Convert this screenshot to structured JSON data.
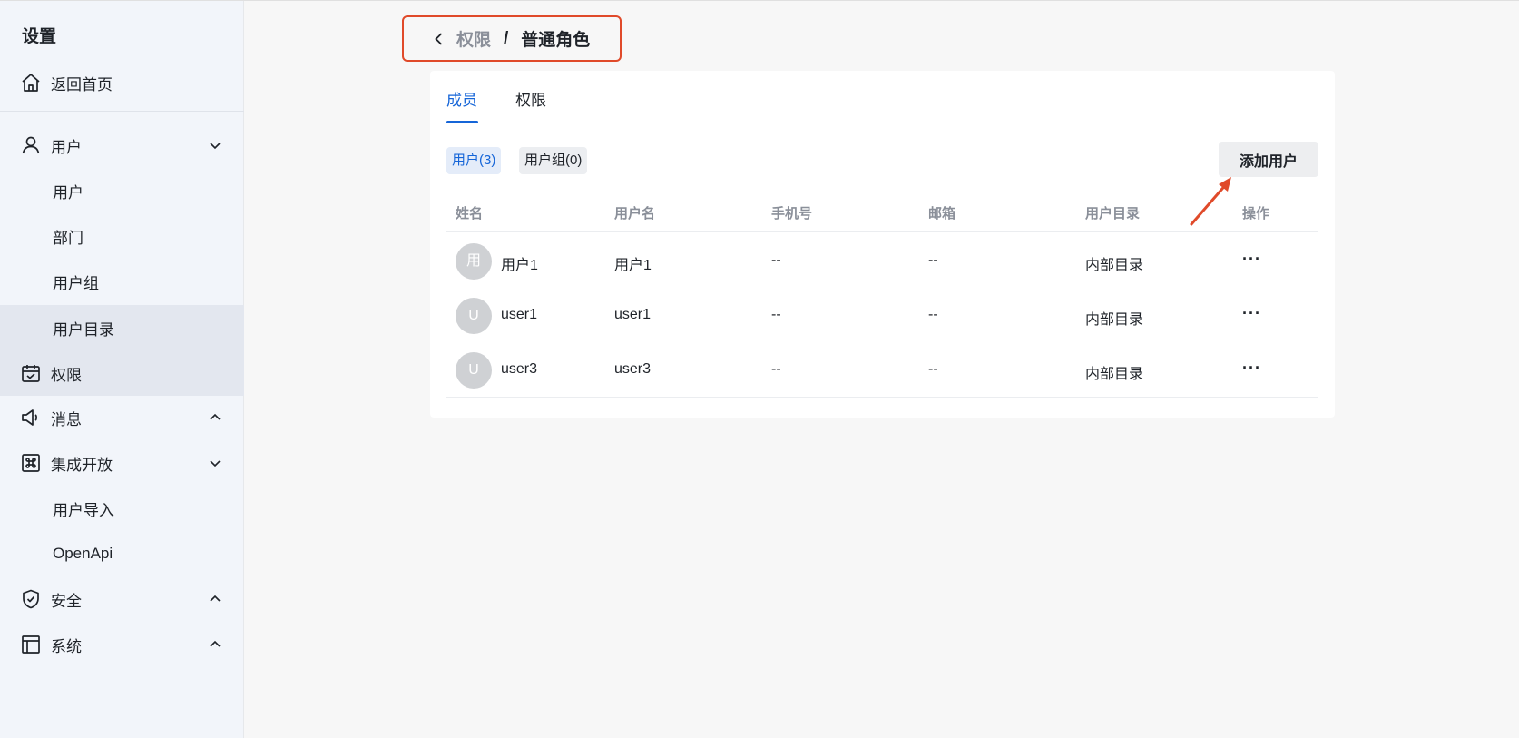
{
  "sidebar": {
    "title": "设置",
    "home": "返回首页",
    "users": {
      "label": "用户",
      "items": [
        "用户",
        "部门",
        "用户组",
        "用户目录"
      ]
    },
    "permissions": "权限",
    "messages": "消息",
    "integration": {
      "label": "集成开放",
      "items": [
        "用户导入",
        "OpenApi"
      ]
    },
    "security": "安全",
    "system": "系统"
  },
  "breadcrumb": {
    "parent": "权限",
    "separator": "/",
    "current": "普通角色"
  },
  "tabs": [
    "成员",
    "权限"
  ],
  "chips": [
    "用户(3)",
    "用户组(0)"
  ],
  "add_button": "添加用户",
  "table": {
    "headers": [
      "姓名",
      "用户名",
      "手机号",
      "邮箱",
      "用户目录",
      "操作"
    ],
    "rows": [
      {
        "avatar": "用",
        "name": "用户1",
        "username": "用户1",
        "phone": "--",
        "email": "--",
        "directory": "内部目录",
        "action": "···"
      },
      {
        "avatar": "U",
        "name": "user1",
        "username": "user1",
        "phone": "--",
        "email": "--",
        "directory": "内部目录",
        "action": "···"
      },
      {
        "avatar": "U",
        "name": "user3",
        "username": "user3",
        "phone": "--",
        "email": "--",
        "directory": "内部目录",
        "action": "···"
      }
    ]
  },
  "colors": {
    "accent": "#1565d8",
    "annotation": "#e04a2a",
    "sidebar_bg": "#f2f5fa"
  }
}
